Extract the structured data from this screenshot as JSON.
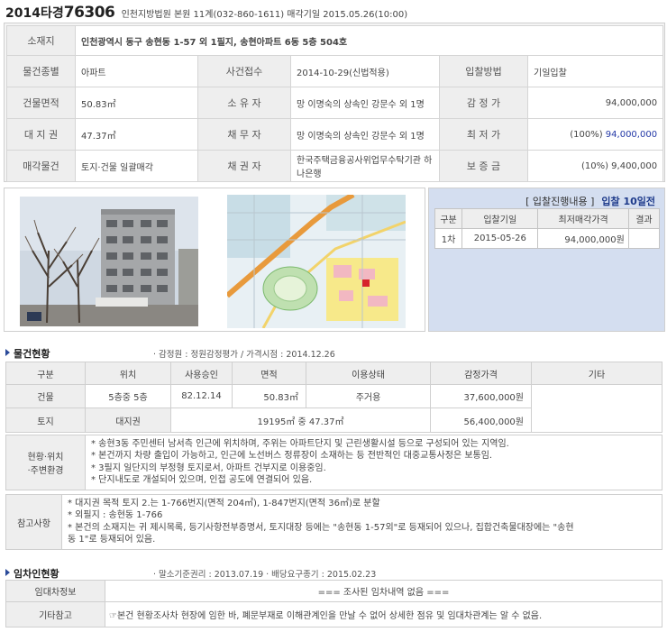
{
  "header": {
    "case_year": "2014타경",
    "case_no": "76306",
    "court": "인천지방법원 본원 11계(032-860-1611) 매각기일 2015.05.26(10:00)"
  },
  "info": {
    "address_label": "소재지",
    "address": "인천광역시 동구 송현동 1-57 외 1필지, 송현아파트 6동 5층 504호",
    "rows": [
      {
        "l1": "물건종별",
        "v1": "아파트",
        "l2": "사건접수",
        "v2": "2014-10-29(신법적용)",
        "l3": "입찰방법",
        "v3": "기일입찰"
      },
      {
        "l1": "건물면적",
        "v1": "50.83㎡",
        "l2": "소 유 자",
        "v2": "망 이명숙의 상속인 강문수 외 1명",
        "l3": "감 정 가",
        "v3": "94,000,000"
      },
      {
        "l1": "대 지 권",
        "v1": "47.37㎡",
        "l2": "채 무 자",
        "v2": "망 이명숙의 상속인 강문수 외 1명",
        "l3": "최 저 가",
        "v3_pct": "(100%)",
        "v3_amt": "94,000,000"
      },
      {
        "l1": "매각물건",
        "v1": "토지·건물 일괄매각",
        "l2": "채 권 자",
        "v2": "한국주택금융공사위업무수탁기관 하나은행",
        "l3": "보 증 금",
        "v3": "(10%) 9,400,000"
      }
    ]
  },
  "photos": {
    "building": "building-photo",
    "map": "location-map"
  },
  "bid": {
    "title": "[ 입찰진행내용 ]",
    "countdown": "입찰 10일전",
    "headers": [
      "구분",
      "입찰기일",
      "최저매각가격",
      "결과"
    ],
    "rows": [
      {
        "round": "1차",
        "date": "2015-05-26",
        "price": "94,000,000원",
        "result": ""
      }
    ]
  },
  "status": {
    "title": "물건현황",
    "sub": "· 감정원 : 정원감정평가 / 가격시점 : 2014.12.26",
    "headers": [
      "구분",
      "위치",
      "사용승인",
      "면적",
      "이용상태",
      "감정가격",
      "기타"
    ],
    "building": {
      "type": "건물",
      "location": "5층중 5층",
      "approval": "82.12.14",
      "area": "50.83㎡",
      "use": "주거용",
      "price": "37,600,000원"
    },
    "land": {
      "type": "토지",
      "location": "대지권",
      "area": "19195㎡ 중 47.37㎡",
      "price": "56,400,000원"
    }
  },
  "surroundings": {
    "label_line1": "현황·위치",
    "label_line2": "·주변환경",
    "lines": [
      "* 송현3동 주민센터 남서측 인근에 위치하며, 주위는 아파트단지 및 근린생활시설 등으로 구성되어 있는 지역임.",
      "* 본건까지 차량 출입이 가능하고, 인근에 노선버스 정류장이 소재하는 등 전반적인 대중교통사정은 보통임.",
      "* 3필지 일단지의 부정형 토지로서, 아파트 건부지로 이용중임.",
      "* 단지내도로 개설되어 있으며, 인접 공도에 연결되어 있음."
    ]
  },
  "reference": {
    "label": "참고사항",
    "lines": [
      "* 대지권 목적 토지 2.는 1-766번지(면적 204㎡), 1-847번지(면적 36㎡)로 분할",
      "* 외필지 : 송현동 1-766",
      "* 본건의 소재지는 귀 제시목록, 등기사항전부증명서, 토지대장 등에는 \"송현동 1-57외\"로 등재되어 있으나, 집합건축물대장에는 \"송현",
      "동 1\"로 등재되어 있음."
    ]
  },
  "tenant": {
    "title": "임차인현황",
    "sub": "· 말소기준권리 : 2013.07.19 · 배당요구종기 : 2015.02.23",
    "info_label": "임대차정보",
    "info_value": "=== 조사된 임차내역 없음 ===",
    "etc_label": "기타참고",
    "etc_value": "☞본건 현황조사차 현장에 임한 바, 폐문부재로 이해관계인을 만날 수 없어 상세한 점유 및 임대차관계는 알 수 없음."
  }
}
